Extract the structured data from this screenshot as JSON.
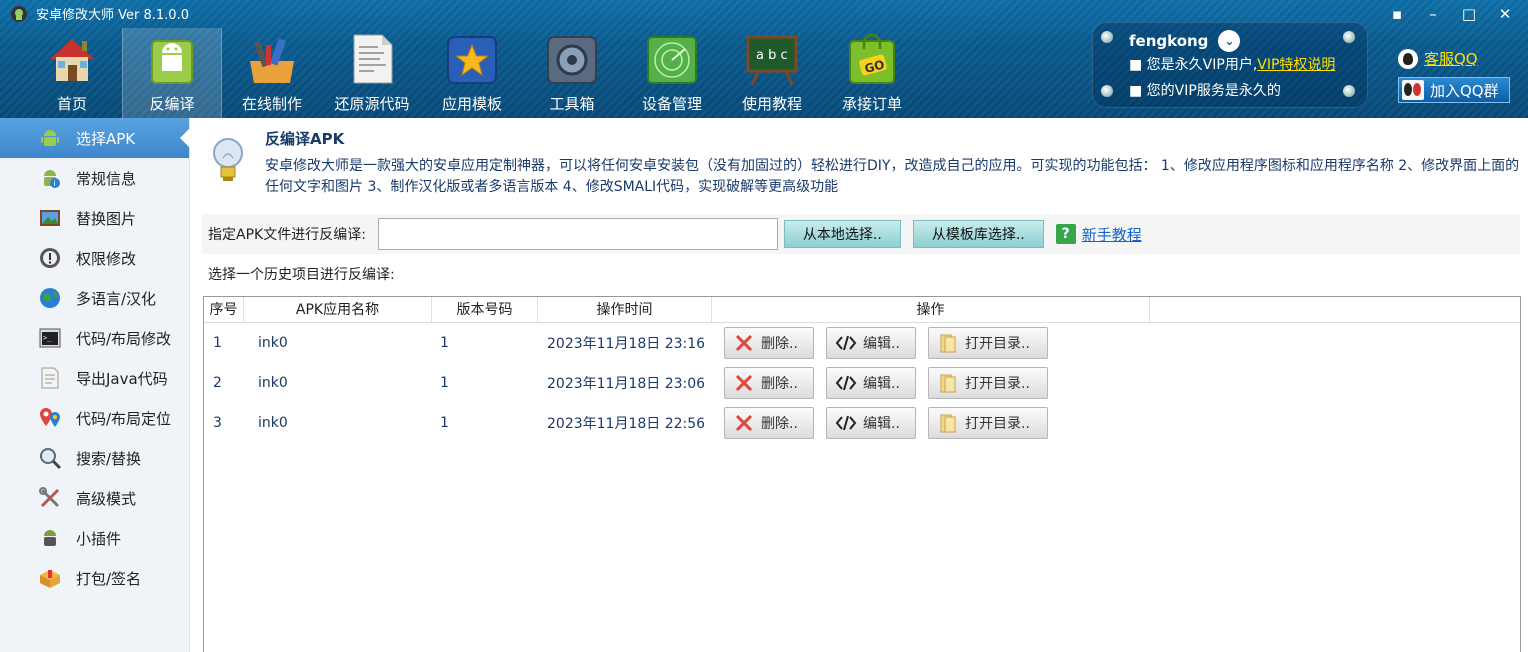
{
  "app": {
    "title": "安卓修改大师 Ver 8.1.0.0",
    "window_controls": [
      "skin-icon",
      "minimize-icon",
      "maximize-icon",
      "close-icon"
    ]
  },
  "toolbar": {
    "items": [
      {
        "label": "首页",
        "icon": "home-icon"
      },
      {
        "label": "反编译",
        "icon": "android-bag-icon",
        "active": true
      },
      {
        "label": "在线制作",
        "icon": "tools-box-icon"
      },
      {
        "label": "还原源代码",
        "icon": "code-document-icon"
      },
      {
        "label": "应用模板",
        "icon": "star-icon"
      },
      {
        "label": "工具箱",
        "icon": "toolbox-icon"
      },
      {
        "label": "设备管理",
        "icon": "radar-icon"
      },
      {
        "label": "使用教程",
        "icon": "blackboard-icon"
      },
      {
        "label": "承接订单",
        "icon": "shopping-bag-go-icon"
      }
    ]
  },
  "user": {
    "name": "fengkong",
    "line1": "■ 您是永久VIP用户,",
    "vip_link": "VIP特权说明",
    "line2": "■ 您的VIP服务是永久的"
  },
  "links": {
    "kefu": "客服QQ",
    "join_qq": "加入QQ群"
  },
  "sidebar": {
    "items": [
      {
        "label": "选择APK",
        "icon": "android-icon",
        "active": true
      },
      {
        "label": "常规信息",
        "icon": "android-info-icon"
      },
      {
        "label": "替换图片",
        "icon": "picture-icon"
      },
      {
        "label": "权限修改",
        "icon": "permission-icon"
      },
      {
        "label": "多语言/汉化",
        "icon": "globe-icon"
      },
      {
        "label": "代码/布局修改",
        "icon": "terminal-icon"
      },
      {
        "label": "导出Java代码",
        "icon": "java-document-icon"
      },
      {
        "label": "代码/布局定位",
        "icon": "location-pin-icon"
      },
      {
        "label": "搜索/替换",
        "icon": "search-icon"
      },
      {
        "label": "高级模式",
        "icon": "wrench-icon"
      },
      {
        "label": "小插件",
        "icon": "plugin-icon"
      },
      {
        "label": "打包/签名",
        "icon": "package-icon"
      }
    ]
  },
  "info": {
    "title": "反编译APK",
    "text": "安卓修改大师是一款强大的安卓应用定制神器，可以将任何安卓安装包（没有加固过的）轻松进行DIY，改造成自己的应用。可实现的功能包括： 1、修改应用程序图标和应用程序名称 2、修改界面上面的任何文字和图片 3、制作汉化版或者多语言版本 4、修改SMALI代码，实现破解等更高级功能"
  },
  "select": {
    "label": "指定APK文件进行反编译:",
    "path_value": "",
    "btn_local": "从本地选择..",
    "btn_template": "从模板库选择..",
    "help_link": "新手教程"
  },
  "history": {
    "label": "选择一个历史项目进行反编译:",
    "columns": [
      "序号",
      "APK应用名称",
      "版本号码",
      "操作时间",
      "操作"
    ],
    "op_labels": {
      "delete": "删除..",
      "edit": "编辑..",
      "open": "打开目录.."
    },
    "rows": [
      {
        "index": "1",
        "name": "ink0",
        "version": "1",
        "time": "2023年11月18日 23:16"
      },
      {
        "index": "2",
        "name": "ink0",
        "version": "1",
        "time": "2023年11月18日 23:06"
      },
      {
        "index": "3",
        "name": "ink0",
        "version": "1",
        "time": "2023年11月18日 22:56"
      }
    ]
  }
}
